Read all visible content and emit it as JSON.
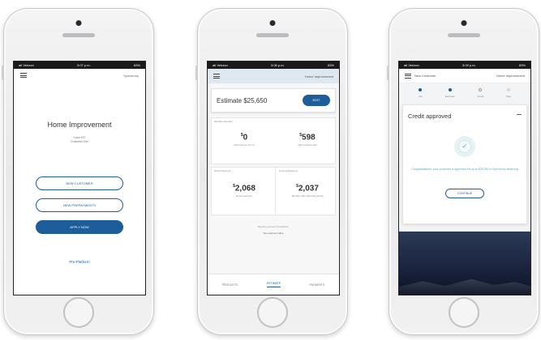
{
  "phone1": {
    "statusbar": {
      "left": "atl Verizon",
      "center": "3:07 p.m.",
      "right": "83%"
    },
    "brand": "Synchrony",
    "title": "Home Improvement",
    "subtitle_line1": "Case #37",
    "subtitle_line2": "Customer Info",
    "buttons": [
      "NEW CUSTOMER",
      "NEW PREPAYMENTS",
      "APPLY NOW"
    ],
    "link": "Pre-Platform"
  },
  "phone2": {
    "statusbar": {
      "left": "atl Verizon",
      "center": "3:06 p.m.",
      "right": "83%"
    },
    "header_title": "Home Improvement",
    "estimate_label": "Estimate $25,650",
    "edit_label": "EDIT",
    "section1_label": "Monthly payment",
    "stat1_value": "0",
    "stat1_caption": "Deferred for 12 mo",
    "stat2_value": "598",
    "stat2_caption": "After interest rate",
    "section2_left_label": "Down Payment",
    "section2_right_label": "Amount financed",
    "stat3_value": "2,068",
    "stat3_caption": "Down payment",
    "stat4_value": "2,037",
    "stat4_caption": "Monthly after deferred period",
    "note1": "Monthly payment breakdown",
    "note2": "See payment table",
    "tabs": [
      "PRODUCTS",
      "ESTIMATE",
      "PAYMENTS"
    ],
    "active_tab": "ESTIMATE"
  },
  "phone3": {
    "statusbar": {
      "left": "atl Verizon",
      "center": "3:09 p.m.",
      "right": "83%"
    },
    "header_left": "New Customer",
    "header_right": "Home Improvement",
    "steps": [
      "Info",
      "Estimate",
      "Credit",
      "Sign"
    ],
    "card_title": "Credit approved",
    "message": "Congratulations, your customer is approved for up to $25,000 in Synchrony financing",
    "continue_label": "CONTINUE"
  },
  "colors": {
    "primary": "#1c5d9a",
    "header_tint": "#dfe8f1",
    "success": "#5aa7b0"
  }
}
